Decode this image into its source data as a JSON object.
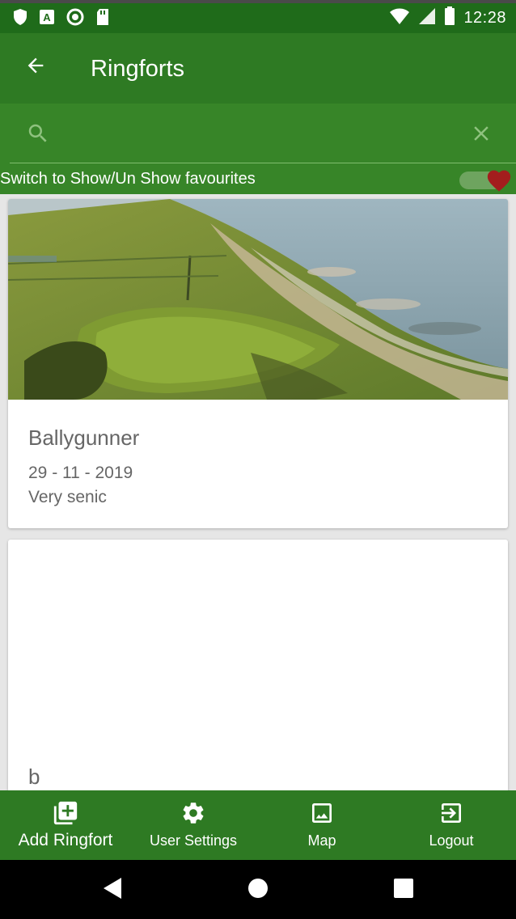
{
  "status_bar": {
    "time": "12:28",
    "left_icons": [
      "shield-icon",
      "a-letter-icon",
      "circle-record-icon",
      "sd-card-icon"
    ],
    "right_icons": [
      "wifi-icon",
      "signal-icon",
      "battery-icon"
    ]
  },
  "app_bar": {
    "title": "Ringforts",
    "back_icon": "arrow-left-icon"
  },
  "search": {
    "value": "",
    "placeholder": "",
    "search_icon": "search-icon",
    "clear_icon": "close-icon"
  },
  "favourites": {
    "label": "Switch to Show/Un Show favourites",
    "toggle_state": "on",
    "heart_color": "#a31d1d"
  },
  "ringforts": [
    {
      "title": "Ballygunner",
      "date": "29 - 11 - 2019",
      "description": "Very senic",
      "has_image": true
    },
    {
      "title": "b",
      "date": "",
      "description": "",
      "has_image": false
    }
  ],
  "bottom_nav": [
    {
      "label": "Add Ringfort",
      "icon": "add-box-icon"
    },
    {
      "label": "User Settings",
      "icon": "gear-icon"
    },
    {
      "label": "Map",
      "icon": "image-icon"
    },
    {
      "label": "Logout",
      "icon": "logout-icon"
    }
  ],
  "colors": {
    "status_bar": "#1f6b1a",
    "primary": "#2e7a23",
    "search_bg": "#378528",
    "card_text": "#666666"
  }
}
